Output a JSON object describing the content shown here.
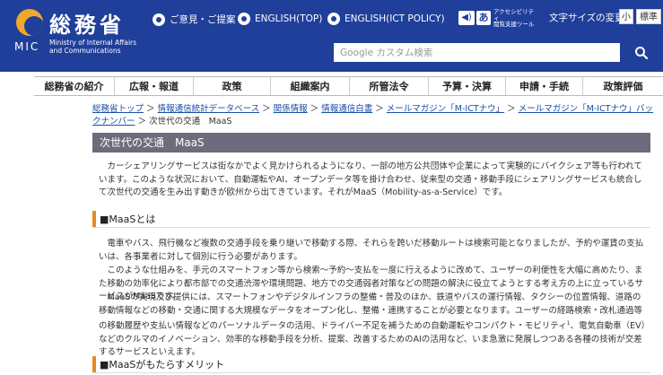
{
  "header": {
    "logo_jp": "総務省",
    "logo_mic": "MIC",
    "logo_en_line1": "Ministry of Internal Affairs",
    "logo_en_line2": "and Communications",
    "links": [
      "ご意見・ご提案",
      "ENGLISH(TOP)",
      "ENGLISH(ICT POLICY)"
    ],
    "accessibility_ico2": "あ",
    "accessibility_line1": "アクセシビリティ",
    "accessibility_line2": "閲覧支援ツール",
    "font_size_label": "文字サイズの変更",
    "font_small": "小",
    "font_standard": "標準",
    "search_placeholder": "Google カスタム検索"
  },
  "nav": [
    "総務省の紹介",
    "広報・報道",
    "政策",
    "組織案内",
    "所管法令",
    "予算・決算",
    "申請・手続",
    "政策評価"
  ],
  "breadcrumb": {
    "links": [
      "総務省トップ",
      "情報通信統計データベース",
      "関係情報",
      "情報通信白書",
      "メールマガジン「M-ICTナウ」",
      "メールマガジン「M-ICTナウ」バックナンバー"
    ],
    "separator": " ＞ ",
    "current": "次世代の交通　MaaS"
  },
  "page_title": "次世代の交通　MaaS",
  "intro": "カーシェアリングサービスは街なかでよく見かけられるようになり、一部の地方公共団体や企業によって実験的にバイクシェア等も行われています。このような状況において、自動運転やAI、オープンデータ等を掛け合わせ、従来型の交通・移動手段にシェアリングサービスも統合して次世代の交通を生み出す動きが欧州から出てきています。それがMaaS（Mobility-as-a-Service）です。",
  "section1": {
    "heading": "■MaaSとは",
    "p1": "電車やバス、飛行機など複数の交通手段を乗り継いで移動する際、それらを跨いだ移動ルートは検索可能となりましたが、予約や運賃の支払いは、各事業者に対して個別に行う必要があります。",
    "p2": "このような仕組みを、手元のスマートフォン等から検索～予約～支払を一度に行えるように改めて、ユーザーの利便性を大幅に高めたり、また移動の効率化により都市部での交通渋滞や環境問題、地方での交通弱者対策などの問題の解決に役立てようとする考え方の上に立っているサービスがMaaSです。",
    "p3a": "MaaSの実現及び提供には、スマートフォンやデジタルインフラの整備・普及のほか、鉄道やバスの運行情報、タクシーの位置情報、道路の移動情報などの移動・交通に関する大規模なデータをオープン化し、整備・連携することが必要となります。ユーザーの経路検索・改札通過等の移動履歴や支払い情報などのパーソナルデータの活用、ドライバー不足を補うための自動運転やコンパクト・モビリティ",
    "p3_sup": "1",
    "p3b": "、電気自動車（EV）などのクルマのイノベーション、効率的な移動手段を分析、提案、改善するためのAIの活用など、いま急激に発展しつつある各種の技術が交差するサービスといえます。"
  },
  "section2": {
    "heading": "■MaaSがもたらすメリット"
  }
}
